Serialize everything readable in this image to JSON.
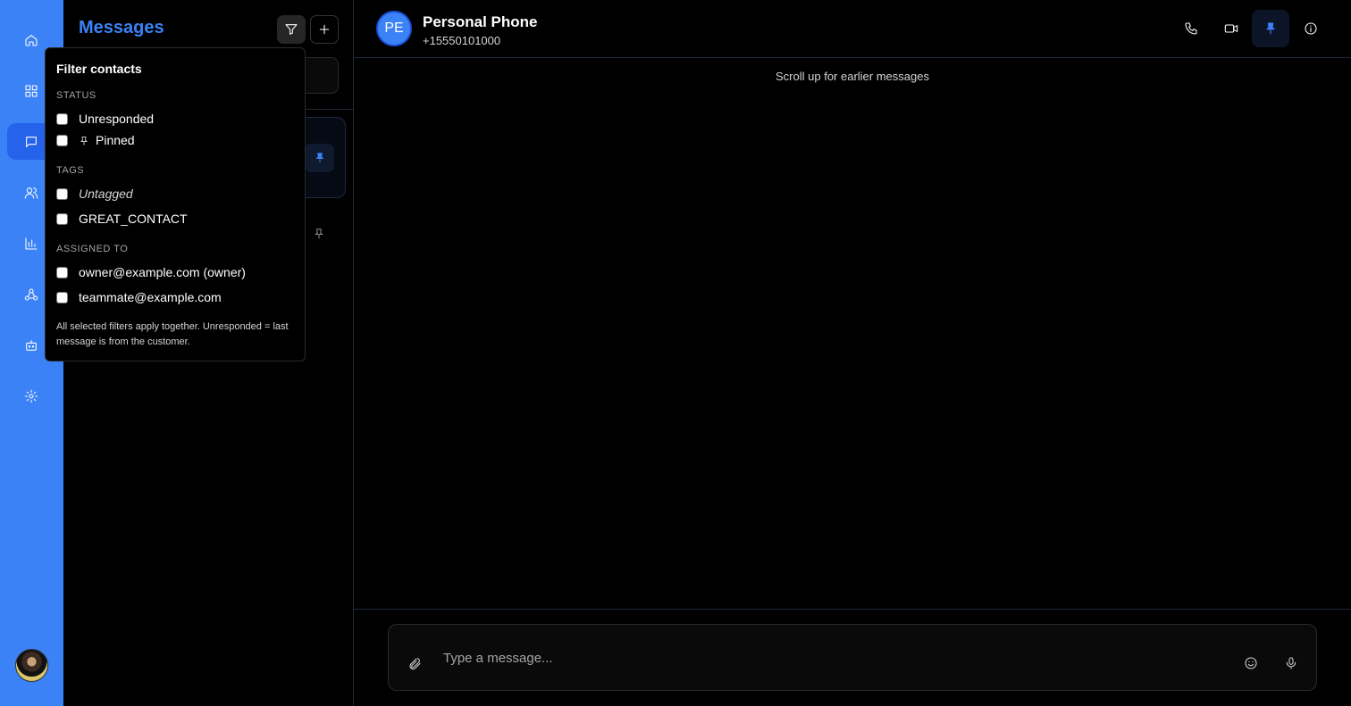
{
  "sidebar": {
    "items": [
      {
        "name": "home-icon"
      },
      {
        "name": "dashboard-icon"
      },
      {
        "name": "messages-icon",
        "active": true
      },
      {
        "name": "contacts-icon"
      },
      {
        "name": "analytics-icon"
      },
      {
        "name": "webhooks-icon"
      },
      {
        "name": "bot-icon"
      },
      {
        "name": "settings-icon"
      }
    ],
    "accent_color": "#3b82f6"
  },
  "contacts_panel": {
    "title": "Messages"
  },
  "filter_popover": {
    "title": "Filter contacts",
    "status_heading": "STATUS",
    "status_options": [
      "Unresponded",
      "Pinned"
    ],
    "tags_heading": "TAGS",
    "tag_options": [
      "Untagged",
      "GREAT_CONTACT"
    ],
    "assigned_heading": "ASSIGNED TO",
    "assigned_options": [
      "owner@example.com (owner)",
      "teammate@example.com"
    ],
    "note": "All selected filters apply together. Unresponded = last message is from the customer."
  },
  "chat": {
    "avatar_initials": "PE",
    "contact_name": "Personal Phone",
    "contact_phone": "+15550101000",
    "scroll_note": "Scroll up for earlier messages",
    "composer_placeholder": "Type a message..."
  }
}
